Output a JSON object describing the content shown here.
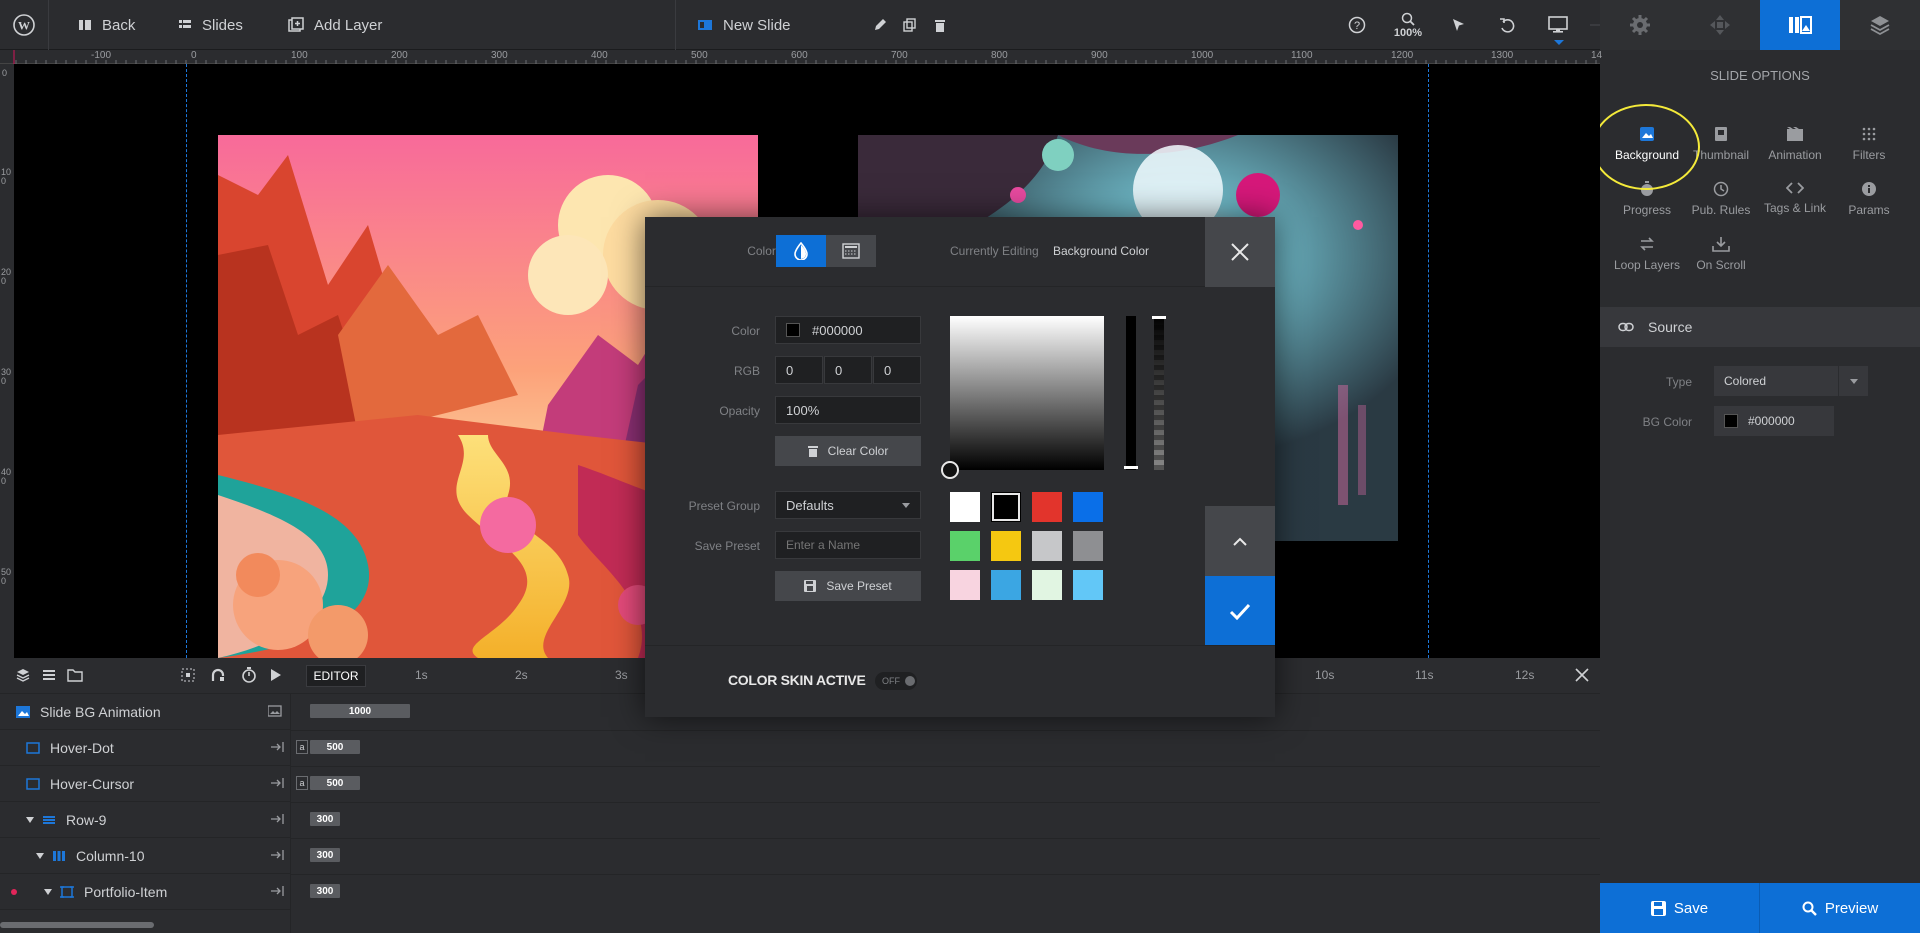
{
  "topbar": {
    "back": "Back",
    "slides": "Slides",
    "add_layer": "Add Layer",
    "slide_name": "New Slide",
    "zoom": "100%"
  },
  "ruler": {
    "top_labels": [
      "-100",
      "0",
      "100",
      "200",
      "300",
      "400",
      "500",
      "600",
      "700",
      "800",
      "900",
      "1000",
      "1100",
      "1200",
      "1300",
      "14"
    ],
    "left_labels": [
      "0",
      "100",
      "200",
      "300",
      "400",
      "500"
    ]
  },
  "panel": {
    "title": "SLIDE OPTIONS",
    "options": [
      {
        "label": "Background",
        "icon": "image-icon"
      },
      {
        "label": "Thumbnail",
        "icon": "thumbnail-icon"
      },
      {
        "label": "Animation",
        "icon": "film-icon"
      },
      {
        "label": "Filters",
        "icon": "filter-icon"
      },
      {
        "label": "Progress",
        "icon": "stopwatch-icon"
      },
      {
        "label": "Pub. Rules",
        "icon": "clock-icon"
      },
      {
        "label": "Tags & Link",
        "icon": "code-icon"
      },
      {
        "label": "Params",
        "icon": "info-icon"
      },
      {
        "label": "Loop Layers",
        "icon": "loop-icon"
      },
      {
        "label": "On Scroll",
        "icon": "download-icon"
      }
    ],
    "source_title": "Source",
    "type_label": "Type",
    "type_value": "Colored",
    "bg_color_label": "BG Color",
    "bg_color_value": "#000000"
  },
  "timeline": {
    "editor_label": "EDITOR",
    "time_labels": [
      "1s",
      "2s",
      "3s",
      "10s",
      "11s",
      "12s"
    ],
    "layers": [
      {
        "name": "Slide BG Animation",
        "bar": "1000",
        "tag": ""
      },
      {
        "name": "Hover-Dot",
        "bar": "500",
        "tag": "a"
      },
      {
        "name": "Hover-Cursor",
        "bar": "500",
        "tag": "a"
      },
      {
        "name": "Row-9",
        "bar": "300",
        "tag": ""
      },
      {
        "name": "Column-10",
        "bar": "300",
        "tag": ""
      },
      {
        "name": "Portfolio-Item",
        "bar": "300",
        "tag": ""
      }
    ]
  },
  "color_modal": {
    "color_type_label": "Color Type",
    "currently_editing_label": "Currently Editing",
    "currently_editing_value": "Background Color",
    "color_label": "Color",
    "color_value": "#000000",
    "rgb_label": "RGB",
    "rgb": [
      "0",
      "0",
      "0"
    ],
    "opacity_label": "Opacity",
    "opacity_value": "100%",
    "clear_color": "Clear Color",
    "preset_group_label": "Preset Group",
    "preset_group_value": "Defaults",
    "save_preset_label": "Save Preset",
    "save_preset_placeholder": "Enter a Name",
    "save_preset_button": "Save Preset",
    "color_skin_label": "COLOR SKIN ACTIVE",
    "color_skin_state": "OFF",
    "swatches": [
      "#ffffff",
      "#000000",
      "#e2342c",
      "#0a6fe8",
      "#5ad16a",
      "#f5c811",
      "#c6c7c9",
      "#8e8f92",
      "#f8d4e0",
      "#3ba6e3",
      "#e1f5e2",
      "#62c7f7"
    ]
  },
  "buttons": {
    "save": "Save",
    "preview": "Preview"
  },
  "colors": {
    "accent": "#0d6fd6",
    "panel_bg": "#2b2c2f",
    "canvas_bg": "#000000",
    "highlight_circle": "#f4ea3a"
  }
}
